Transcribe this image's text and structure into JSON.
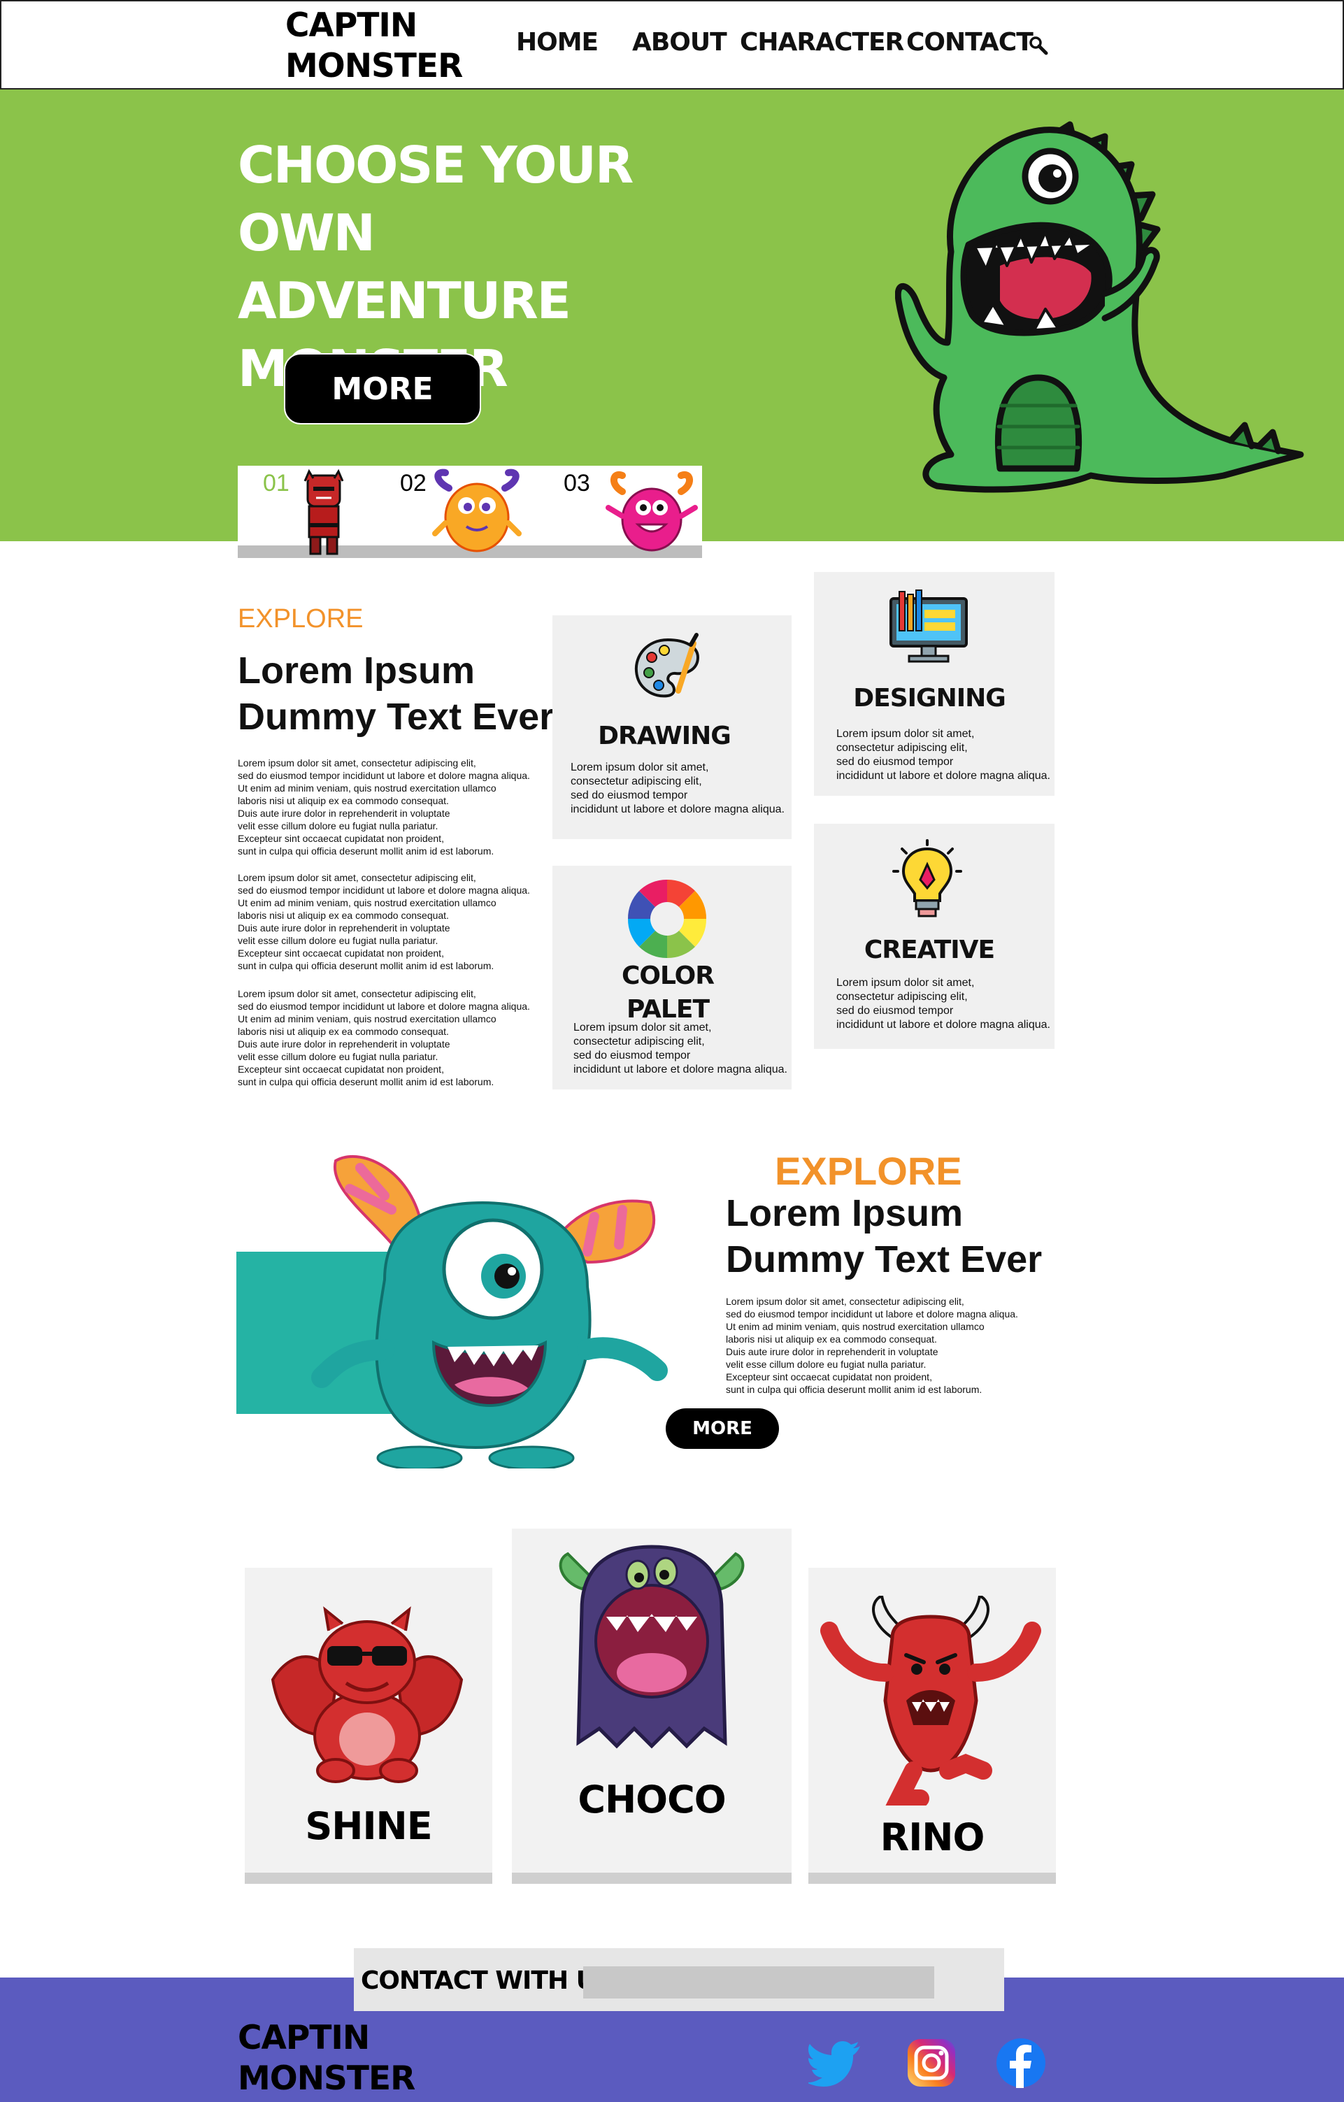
{
  "header": {
    "logo": [
      "CAPTIN",
      "MONSTER"
    ],
    "nav": [
      "HOME",
      "ABOUT",
      "CHARACTER",
      "CONTACT"
    ],
    "search_icon": "search-icon"
  },
  "hero": {
    "title_lines": [
      "CHOOSE YOUR",
      "OWN ADVENTURE",
      "MONSTER"
    ],
    "more_label": "MORE",
    "slides": [
      "01",
      "02",
      "03"
    ],
    "active_slide": "01",
    "colors": {
      "bg": "#8bc34a",
      "active_num": "#8bc34a"
    }
  },
  "explore1": {
    "eyebrow": "EXPLORE",
    "heading": [
      "Lorem Ipsum",
      "Dummy Text Ever"
    ],
    "paragraph": "Lorem ipsum dolor sit amet, consectetur adipiscing elit,\n sed do eiusmod tempor incididunt ut labore et dolore magna aliqua.\nUt enim ad minim veniam, quis nostrud exercitation ullamco\n laboris nisi ut aliquip ex ea commodo consequat.\nDuis aute irure dolor in reprehenderit in voluptate\nvelit esse cillum dolore eu fugiat nulla pariatur.\n Excepteur sint occaecat cupidatat non proident,\nsunt in culpa qui officia deserunt mollit anim id est laborum.",
    "cards": [
      {
        "title": "DRAWING",
        "text": "Lorem ipsum dolor sit amet,\n consectetur adipiscing elit,\nsed do eiusmod tempor\nincididunt ut labore et dolore magna aliqua.",
        "icon": "palette-icon"
      },
      {
        "title": "DESIGNING",
        "text": "Lorem ipsum dolor sit amet,\n consectetur adipiscing elit,\nsed do eiusmod tempor\nincididunt ut labore et dolore magna aliqua.",
        "icon": "monitor-design-icon"
      },
      {
        "title": "COLOR\nPALET",
        "text": "Lorem ipsum dolor sit amet,\n consectetur adipiscing elit,\nsed do eiusmod tempor\nincididunt ut labore et dolore magna aliqua.",
        "icon": "color-wheel-icon"
      },
      {
        "title": "CREATIVE",
        "text": "Lorem ipsum dolor sit amet,\n consectetur adipiscing elit,\nsed do eiusmod tempor\nincididunt ut labore et dolore magna aliqua.",
        "icon": "lightbulb-pen-icon"
      }
    ]
  },
  "explore2": {
    "eyebrow": "EXPLORE",
    "heading": [
      "Lorem Ipsum",
      "Dummy Text Ever"
    ],
    "paragraph": "Lorem ipsum dolor sit amet, consectetur adipiscing elit,\n sed do eiusmod tempor incididunt ut labore et dolore magna aliqua.\nUt enim ad minim veniam, quis nostrud exercitation ullamco\n laboris nisi ut aliquip ex ea commodo consequat.\nDuis aute irure dolor in reprehenderit in voluptate\nvelit esse cillum dolore eu fugiat nulla pariatur.\n Excepteur sint occaecat cupidatat non proident,\nsunt in culpa qui officia deserunt mollit anim id est laborum.",
    "more_label": "MORE",
    "colors": {
      "accent": "#f2922a",
      "teal": "#25b3a4"
    }
  },
  "monsters": [
    {
      "name": "SHINE"
    },
    {
      "name": "CHOCO"
    },
    {
      "name": "RINO"
    }
  ],
  "footer": {
    "contact_label": "CONTACT WITH US",
    "contact_value": "",
    "logo": [
      "CAPTIN",
      "MONSTER"
    ],
    "social": [
      "twitter-icon",
      "instagram-icon",
      "facebook-icon"
    ],
    "colors": {
      "bg": "#5b5bbf"
    }
  }
}
